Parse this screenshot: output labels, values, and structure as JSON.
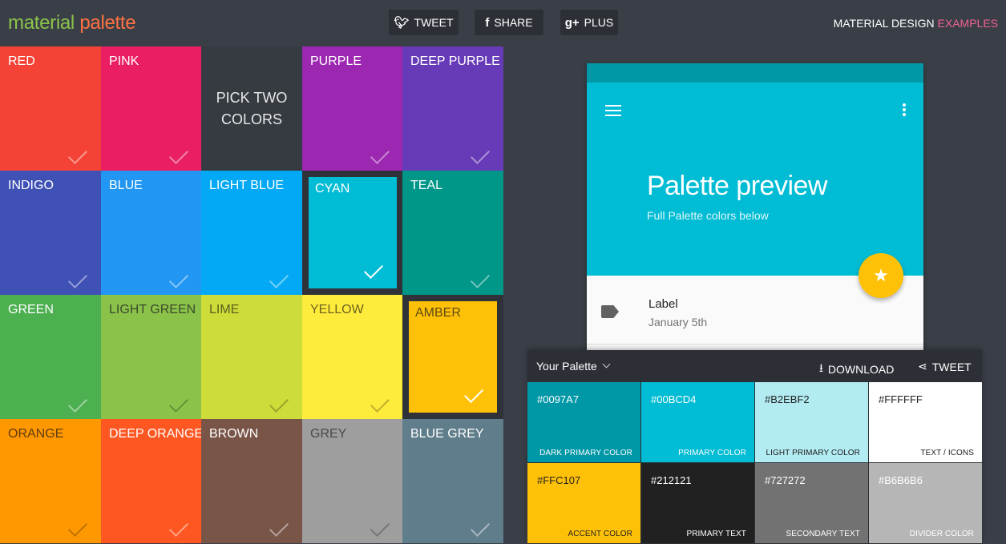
{
  "header": {
    "logo_part1": "material",
    "logo_part2": "palette",
    "tweet_label": "TWEET",
    "share_label": "SHARE",
    "plus_label": "PLUS",
    "md_link_main": "MATERIAL DESIGN",
    "md_link_accent": "EXAMPLES"
  },
  "grid": {
    "red": "RED",
    "pink": "PINK",
    "pick_line1": "PICK TWO",
    "pick_line2": "COLORS",
    "purple": "PURPLE",
    "deep_purple": "DEEP PURPLE",
    "indigo": "INDIGO",
    "blue": "BLUE",
    "light_blue": "LIGHT BLUE",
    "cyan": "CYAN",
    "teal": "TEAL",
    "green": "GREEN",
    "light_green": "LIGHT GREEN",
    "lime": "LIME",
    "yellow": "YELLOW",
    "amber": "AMBER",
    "orange": "ORANGE",
    "deep_orange": "DEEP ORANGE",
    "brown": "BROWN",
    "grey": "GREY",
    "blue_grey": "BLUE GREY"
  },
  "colors": {
    "red": "#f44336",
    "pink": "#e91e63",
    "purple": "#9c27b0",
    "deep_purple": "#673ab7",
    "indigo": "#3f51b5",
    "blue": "#2196f3",
    "light_blue": "#03a9f4",
    "cyan": "#00bcd4",
    "teal": "#009688",
    "green": "#4caf50",
    "light_green": "#8bc34a",
    "lime": "#cddc39",
    "yellow": "#ffeb3b",
    "amber": "#ffc107",
    "orange": "#ff9800",
    "deep_orange": "#ff5722",
    "brown": "#795548",
    "grey": "#9e9e9e",
    "blue_grey": "#607d8b"
  },
  "preview": {
    "title": "Palette preview",
    "subtitle": "Full Palette colors below",
    "item_label": "Label",
    "item_date": "January 5th"
  },
  "palette": {
    "title": "Your Palette",
    "download_label": "DOWNLOAD",
    "tweet_label": "TWEET",
    "swatches": [
      {
        "hex": "#0097A7",
        "role": "DARK PRIMARY COLOR"
      },
      {
        "hex": "#00BCD4",
        "role": "PRIMARY COLOR"
      },
      {
        "hex": "#B2EBF2",
        "role": "LIGHT PRIMARY COLOR"
      },
      {
        "hex": "#FFFFFF",
        "role": "TEXT / ICONS"
      },
      {
        "hex": "#FFC107",
        "role": "ACCENT COLOR"
      },
      {
        "hex": "#212121",
        "role": "PRIMARY TEXT"
      },
      {
        "hex": "#727272",
        "role": "SECONDARY TEXT"
      },
      {
        "hex": "#B6B6B6",
        "role": "DIVIDER COLOR"
      }
    ]
  }
}
